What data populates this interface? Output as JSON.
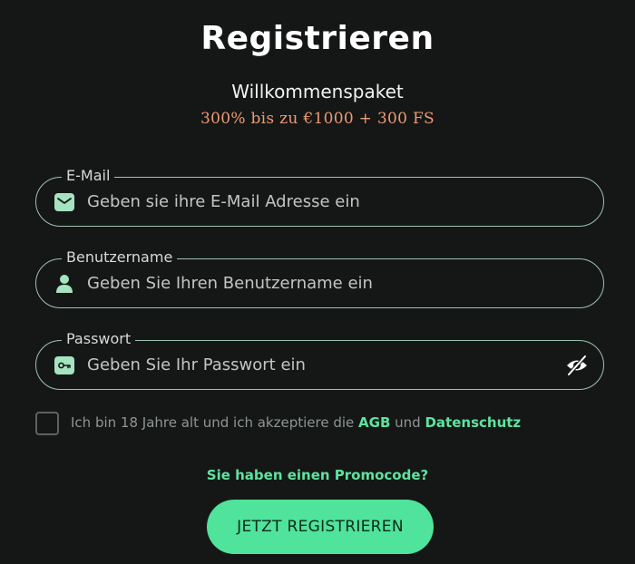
{
  "title": "Registrieren",
  "subtitle": "Willkommenspaket",
  "bonus": "300% bis zu €1000 + 300 FS",
  "fields": {
    "email": {
      "label": "E-Mail",
      "placeholder": "Geben sie ihre E-Mail Adresse ein",
      "value": "",
      "icon": "envelope-icon"
    },
    "username": {
      "label": "Benutzername",
      "placeholder": "Geben Sie Ihren Benutzername ein",
      "value": "",
      "icon": "user-icon"
    },
    "password": {
      "label": "Passwort",
      "placeholder": "Geben Sie Ihr Passwort ein",
      "value": "",
      "icon": "key-icon",
      "toggle_icon": "eye-slash-icon"
    }
  },
  "terms": {
    "checked": false,
    "text_before": "Ich bin 18 Jahre alt und ich akzeptiere die ",
    "agb_link": "AGB",
    "text_middle": " und ",
    "privacy_link": "Datenschutz"
  },
  "promo_link": "Sie haben einen Promocode?",
  "register_button": "JETZT REGISTRIEREN",
  "colors": {
    "background": "#151716",
    "accent": "#4fe39b",
    "bonus_text": "#ee9a73",
    "field_border": "#9cc3ac"
  }
}
